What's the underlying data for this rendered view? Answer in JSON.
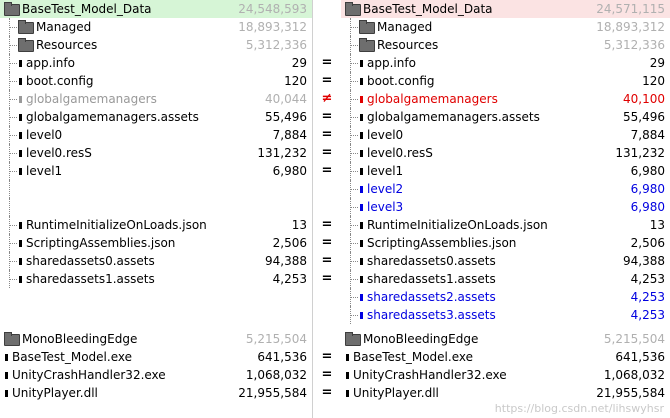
{
  "left": {
    "root": {
      "label": "BaseTest_Model_Data",
      "size": "24,548,593"
    },
    "rows": [
      {
        "label": "Managed",
        "size": "18,893,312",
        "type": "folder",
        "color": "black",
        "sizeColor": "gray"
      },
      {
        "label": "Resources",
        "size": "5,312,336",
        "type": "folder",
        "color": "black",
        "sizeColor": "gray"
      },
      {
        "label": "app.info",
        "size": "29",
        "type": "file",
        "color": "black",
        "sizeColor": "black"
      },
      {
        "label": "boot.config",
        "size": "120",
        "type": "file",
        "color": "black",
        "sizeColor": "black"
      },
      {
        "label": "globalgamemanagers",
        "size": "40,044",
        "type": "file",
        "color": "gray",
        "sizeColor": "gray"
      },
      {
        "label": "globalgamemanagers.assets",
        "size": "55,496",
        "type": "file",
        "color": "black",
        "sizeColor": "black"
      },
      {
        "label": "level0",
        "size": "7,884",
        "type": "file",
        "color": "black",
        "sizeColor": "black"
      },
      {
        "label": "level0.resS",
        "size": "131,232",
        "type": "file",
        "color": "black",
        "sizeColor": "black"
      },
      {
        "label": "level1",
        "size": "6,980",
        "type": "file",
        "color": "black",
        "sizeColor": "black"
      },
      {
        "label": "",
        "size": "",
        "type": "blank",
        "color": "black",
        "sizeColor": "black"
      },
      {
        "label": "",
        "size": "",
        "type": "blank",
        "color": "black",
        "sizeColor": "black"
      },
      {
        "label": "RuntimeInitializeOnLoads.json",
        "size": "13",
        "type": "file",
        "color": "black",
        "sizeColor": "black"
      },
      {
        "label": "ScriptingAssemblies.json",
        "size": "2,506",
        "type": "file",
        "color": "black",
        "sizeColor": "black"
      },
      {
        "label": "sharedassets0.assets",
        "size": "94,388",
        "type": "file",
        "color": "black",
        "sizeColor": "black"
      },
      {
        "label": "sharedassets1.assets",
        "size": "4,253",
        "type": "file",
        "color": "black",
        "sizeColor": "black"
      },
      {
        "label": "",
        "size": "",
        "type": "blank",
        "color": "black",
        "sizeColor": "black"
      },
      {
        "label": "",
        "size": "",
        "type": "blank",
        "color": "black",
        "sizeColor": "black"
      }
    ],
    "bottom": [
      {
        "label": "MonoBleedingEdge",
        "size": "5,215,504",
        "type": "folder",
        "sizeColor": "gray"
      },
      {
        "label": "BaseTest_Model.exe",
        "size": "641,536",
        "type": "file",
        "sizeColor": "black"
      },
      {
        "label": "UnityCrashHandler32.exe",
        "size": "1,068,032",
        "type": "file",
        "sizeColor": "black"
      },
      {
        "label": "UnityPlayer.dll",
        "size": "21,955,584",
        "type": "file",
        "sizeColor": "black"
      }
    ]
  },
  "right": {
    "root": {
      "label": "BaseTest_Model_Data",
      "size": "24,571,115"
    },
    "rows": [
      {
        "label": "Managed",
        "size": "18,893,312",
        "type": "folder",
        "color": "black",
        "sizeColor": "gray"
      },
      {
        "label": "Resources",
        "size": "5,312,336",
        "type": "folder",
        "color": "black",
        "sizeColor": "gray"
      },
      {
        "label": "app.info",
        "size": "29",
        "type": "file",
        "color": "black",
        "sizeColor": "black"
      },
      {
        "label": "boot.config",
        "size": "120",
        "type": "file",
        "color": "black",
        "sizeColor": "black"
      },
      {
        "label": "globalgamemanagers",
        "size": "40,100",
        "type": "file",
        "color": "red",
        "sizeColor": "red"
      },
      {
        "label": "globalgamemanagers.assets",
        "size": "55,496",
        "type": "file",
        "color": "black",
        "sizeColor": "black"
      },
      {
        "label": "level0",
        "size": "7,884",
        "type": "file",
        "color": "black",
        "sizeColor": "black"
      },
      {
        "label": "level0.resS",
        "size": "131,232",
        "type": "file",
        "color": "black",
        "sizeColor": "black"
      },
      {
        "label": "level1",
        "size": "6,980",
        "type": "file",
        "color": "black",
        "sizeColor": "black"
      },
      {
        "label": "level2",
        "size": "6,980",
        "type": "file",
        "color": "blue",
        "sizeColor": "blue"
      },
      {
        "label": "level3",
        "size": "6,980",
        "type": "file",
        "color": "blue",
        "sizeColor": "blue"
      },
      {
        "label": "RuntimeInitializeOnLoads.json",
        "size": "13",
        "type": "file",
        "color": "black",
        "sizeColor": "black"
      },
      {
        "label": "ScriptingAssemblies.json",
        "size": "2,506",
        "type": "file",
        "color": "black",
        "sizeColor": "black"
      },
      {
        "label": "sharedassets0.assets",
        "size": "94,388",
        "type": "file",
        "color": "black",
        "sizeColor": "black"
      },
      {
        "label": "sharedassets1.assets",
        "size": "4,253",
        "type": "file",
        "color": "black",
        "sizeColor": "black"
      },
      {
        "label": "sharedassets2.assets",
        "size": "4,253",
        "type": "file",
        "color": "blue",
        "sizeColor": "blue"
      },
      {
        "label": "sharedassets3.assets",
        "size": "4,253",
        "type": "file",
        "color": "blue",
        "sizeColor": "blue"
      }
    ],
    "bottom": [
      {
        "label": "MonoBleedingEdge",
        "size": "5,215,504",
        "type": "folder",
        "sizeColor": "gray"
      },
      {
        "label": "BaseTest_Model.exe",
        "size": "641,536",
        "type": "file",
        "sizeColor": "black"
      },
      {
        "label": "UnityCrashHandler32.exe",
        "size": "1,068,032",
        "type": "file",
        "sizeColor": "black"
      },
      {
        "label": "UnityPlayer.dll",
        "size": "21,955,584",
        "type": "file",
        "sizeColor": "black"
      }
    ]
  },
  "marks": {
    "rows": [
      "",
      "",
      "",
      "=",
      "=",
      "≠",
      "=",
      "=",
      "=",
      "=",
      "",
      "",
      "=",
      "=",
      "=",
      "=",
      "",
      ""
    ],
    "bottom": [
      "",
      "=",
      "=",
      "="
    ]
  },
  "watermark": "https://blog.csdn.net/lihswyhsr",
  "colors": {
    "green_hl": "#d6f5d6",
    "pink_hl": "#fbe3e3",
    "red": "#e00000",
    "blue": "#0000e0"
  }
}
